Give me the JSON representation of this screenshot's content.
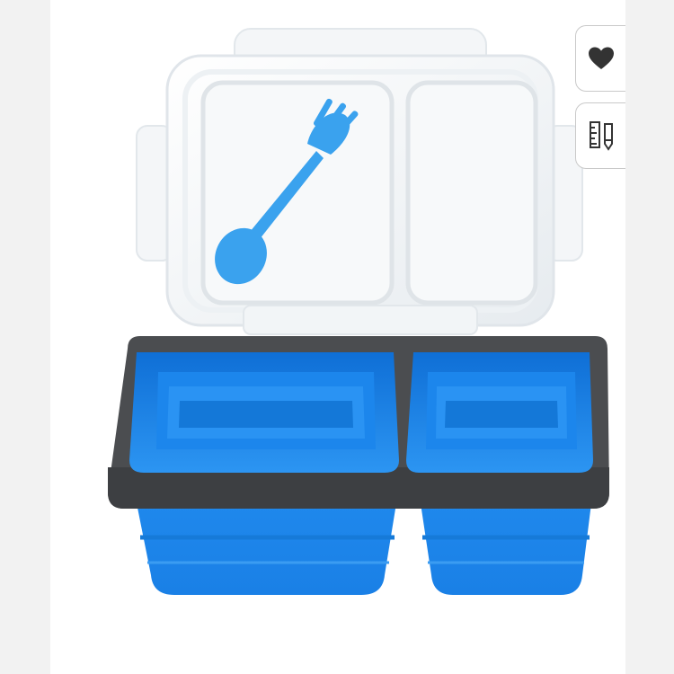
{
  "product": {
    "image_alt": "",
    "colors": {
      "silicone": "#1e8ff0",
      "rim": "#4b4d50",
      "lid": "#f3f6f8",
      "spork": "#3aa2ee"
    }
  },
  "actions": {
    "favorite_icon": "heart-icon",
    "size_guide_icon": "size-guide-icon"
  }
}
